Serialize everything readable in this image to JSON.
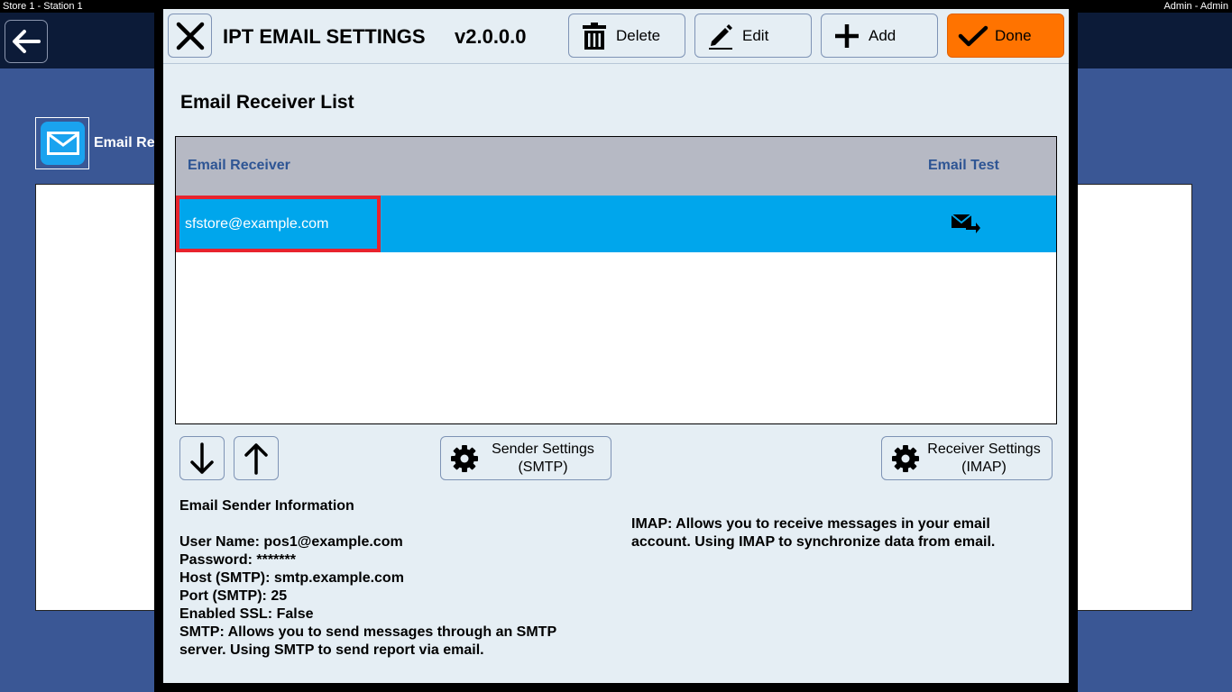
{
  "topbar": {
    "left": "Store 1 - Station 1",
    "right": "Admin - Admin"
  },
  "background": {
    "label": "Email Re"
  },
  "dialog": {
    "title": "IPT EMAIL SETTINGS",
    "version": "v2.0.0.0",
    "buttons": {
      "delete": "Delete",
      "edit": "Edit",
      "add": "Add",
      "done": "Done"
    },
    "section_title": "Email Receiver List",
    "table": {
      "headers": {
        "receiver": "Email Receiver",
        "test": "Email Test"
      },
      "rows": [
        {
          "email": "sfstore@example.com"
        }
      ]
    },
    "sender_settings": {
      "line1": "Sender Settings",
      "line2": "(SMTP)"
    },
    "receiver_settings": {
      "line1": "Receiver Settings",
      "line2": "(IMAP)"
    },
    "sender_info": {
      "heading": "Email Sender Information",
      "user": "User Name: pos1@example.com",
      "password": "Password: *******",
      "host": "Host (SMTP): smtp.example.com",
      "port": "Port (SMTP): 25",
      "ssl": "Enabled SSL: False",
      "smtp_note_1": "SMTP: Allows you to send messages through an SMTP",
      "smtp_note_2": "server. Using SMTP to send report via email."
    },
    "imap_note": "IMAP: Allows you to receive messages in your email account. Using IMAP to synchronize data from email."
  },
  "colors": {
    "accent_done": "#ff7300",
    "selected_row": "#00a6ec",
    "highlight": "#e8232d",
    "header_text": "#2e5594"
  }
}
